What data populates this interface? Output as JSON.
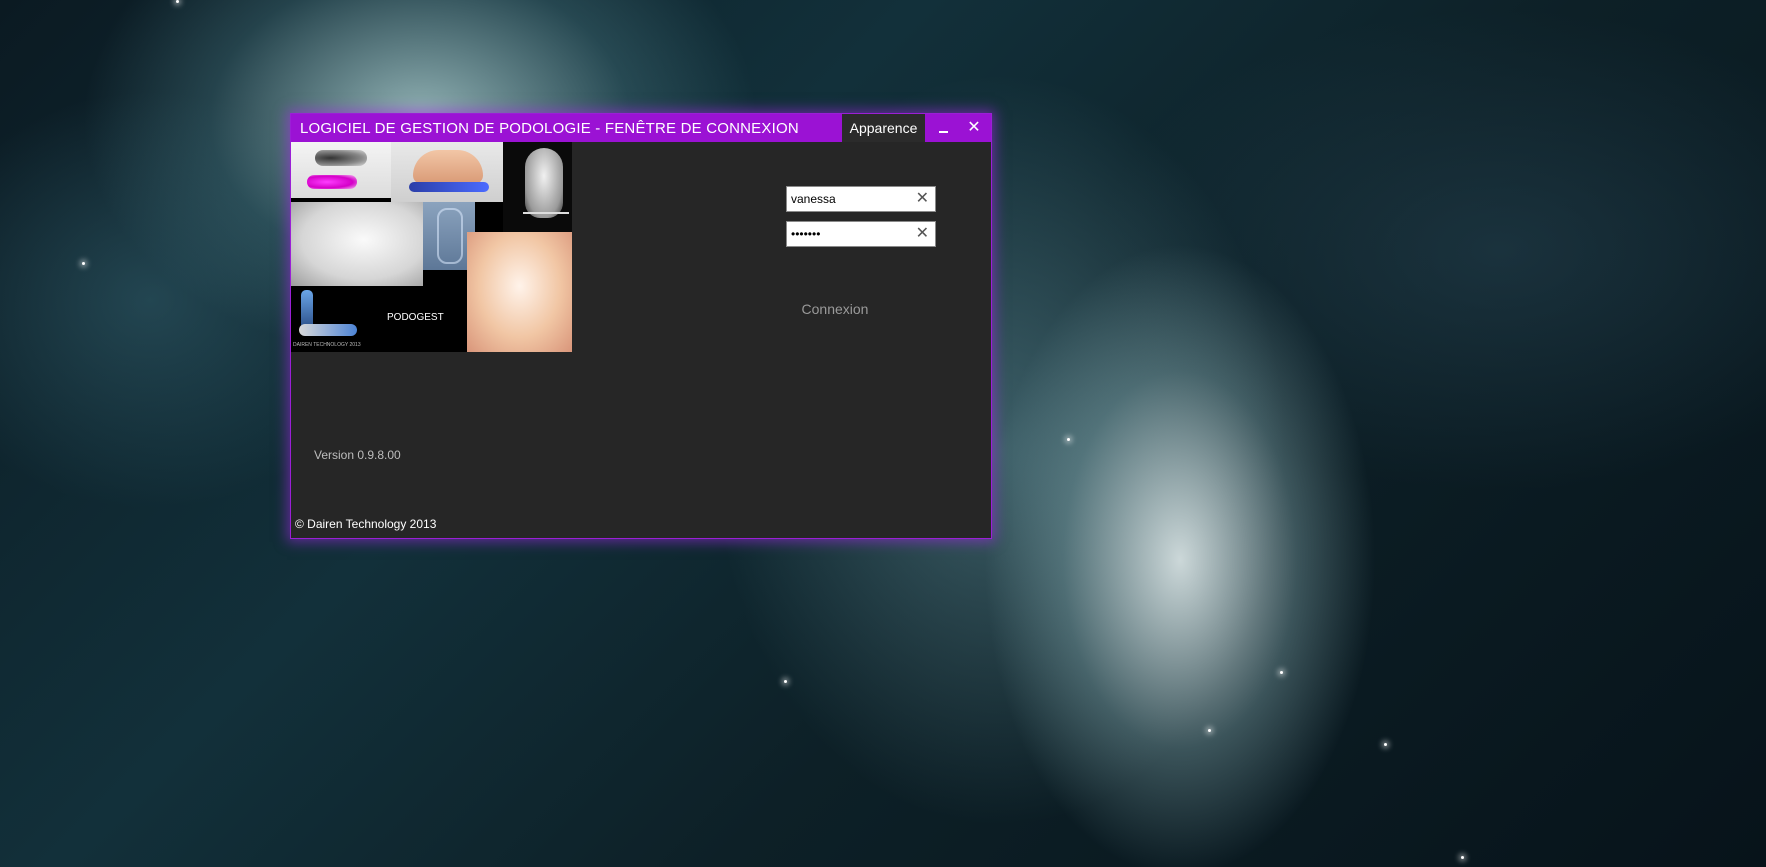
{
  "window": {
    "title": "LOGICIEL DE GESTION DE PODOLOGIE - FENÊTRE DE CONNEXION",
    "appearance_label": "Apparence",
    "minimize_icon": "minimize-icon",
    "close_icon": "close-icon"
  },
  "collage": {
    "brand": "PODOGEST",
    "caption": "DAIREN TECHNOLOGY 2013"
  },
  "login": {
    "username_value": "vanessa",
    "password_value": "•••••••",
    "clear_icon": "x-icon",
    "submit_label": "Connexion"
  },
  "footer": {
    "version": "Version 0.9.8.00",
    "copyright": "© Dairen Technology 2013"
  },
  "colors": {
    "accent": "#9b12d4",
    "panel": "#262626"
  }
}
